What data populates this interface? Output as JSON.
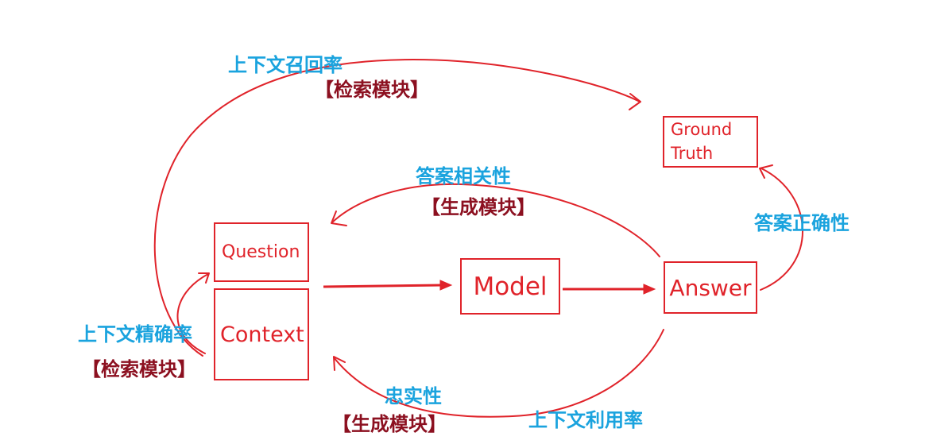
{
  "nodes": {
    "question": "Question",
    "context": "Context",
    "model": "Model",
    "answer": "Answer",
    "ground_truth_line1": "Ground",
    "ground_truth_line2": "Truth"
  },
  "labels": {
    "context_recall": "上下文召回率",
    "context_recall_module": "【检索模块】",
    "answer_relevance": "答案相关性",
    "answer_relevance_module": "【生成模块】",
    "answer_correctness": "答案正确性",
    "context_precision": "上下文精确率",
    "context_precision_module": "【检索模块】",
    "faithfulness": "忠实性",
    "faithfulness_module": "【生成模块】",
    "context_utilization": "上下文利用率"
  },
  "colors": {
    "line": "#e0232a",
    "metric_text": "#1aa3de",
    "module_text": "#8c1020"
  }
}
